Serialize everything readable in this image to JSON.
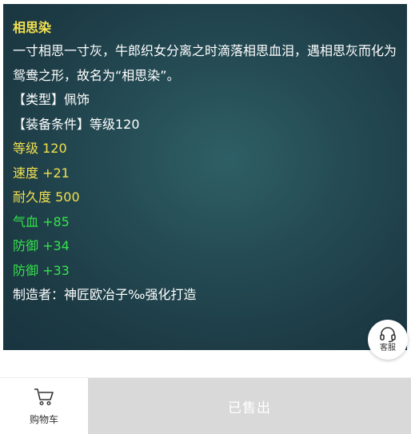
{
  "item": {
    "name": "相思染",
    "description": "一寸相思一寸灰，牛郎织女分离之时滴落相思血泪，遇相思灰而化为鸳鸯之形，故名为“相思染”。",
    "type_line": "【类型】佩饰",
    "requirement_line": "【装备条件】等级120",
    "level_line": "等级 120",
    "speed_line": "速度 +21",
    "durability_line": "耐久度 500",
    "hp_line": "气血 +85",
    "defense_line_1": "防御 +34",
    "defense_line_2": "防御 +33",
    "maker_line": "制造者：神匠欧冶子‰强化打造"
  },
  "service": {
    "icon": "headset-icon",
    "label": "客服"
  },
  "bottom_bar": {
    "cart_icon": "shopping-cart-icon",
    "cart_label": "购物车",
    "sold_label": "已售出"
  },
  "colors": {
    "panel_bg": "#244a53",
    "title_yellow": "#f3e04e",
    "stat_green": "#35e24b",
    "sold_bg": "#d9d9d9"
  }
}
